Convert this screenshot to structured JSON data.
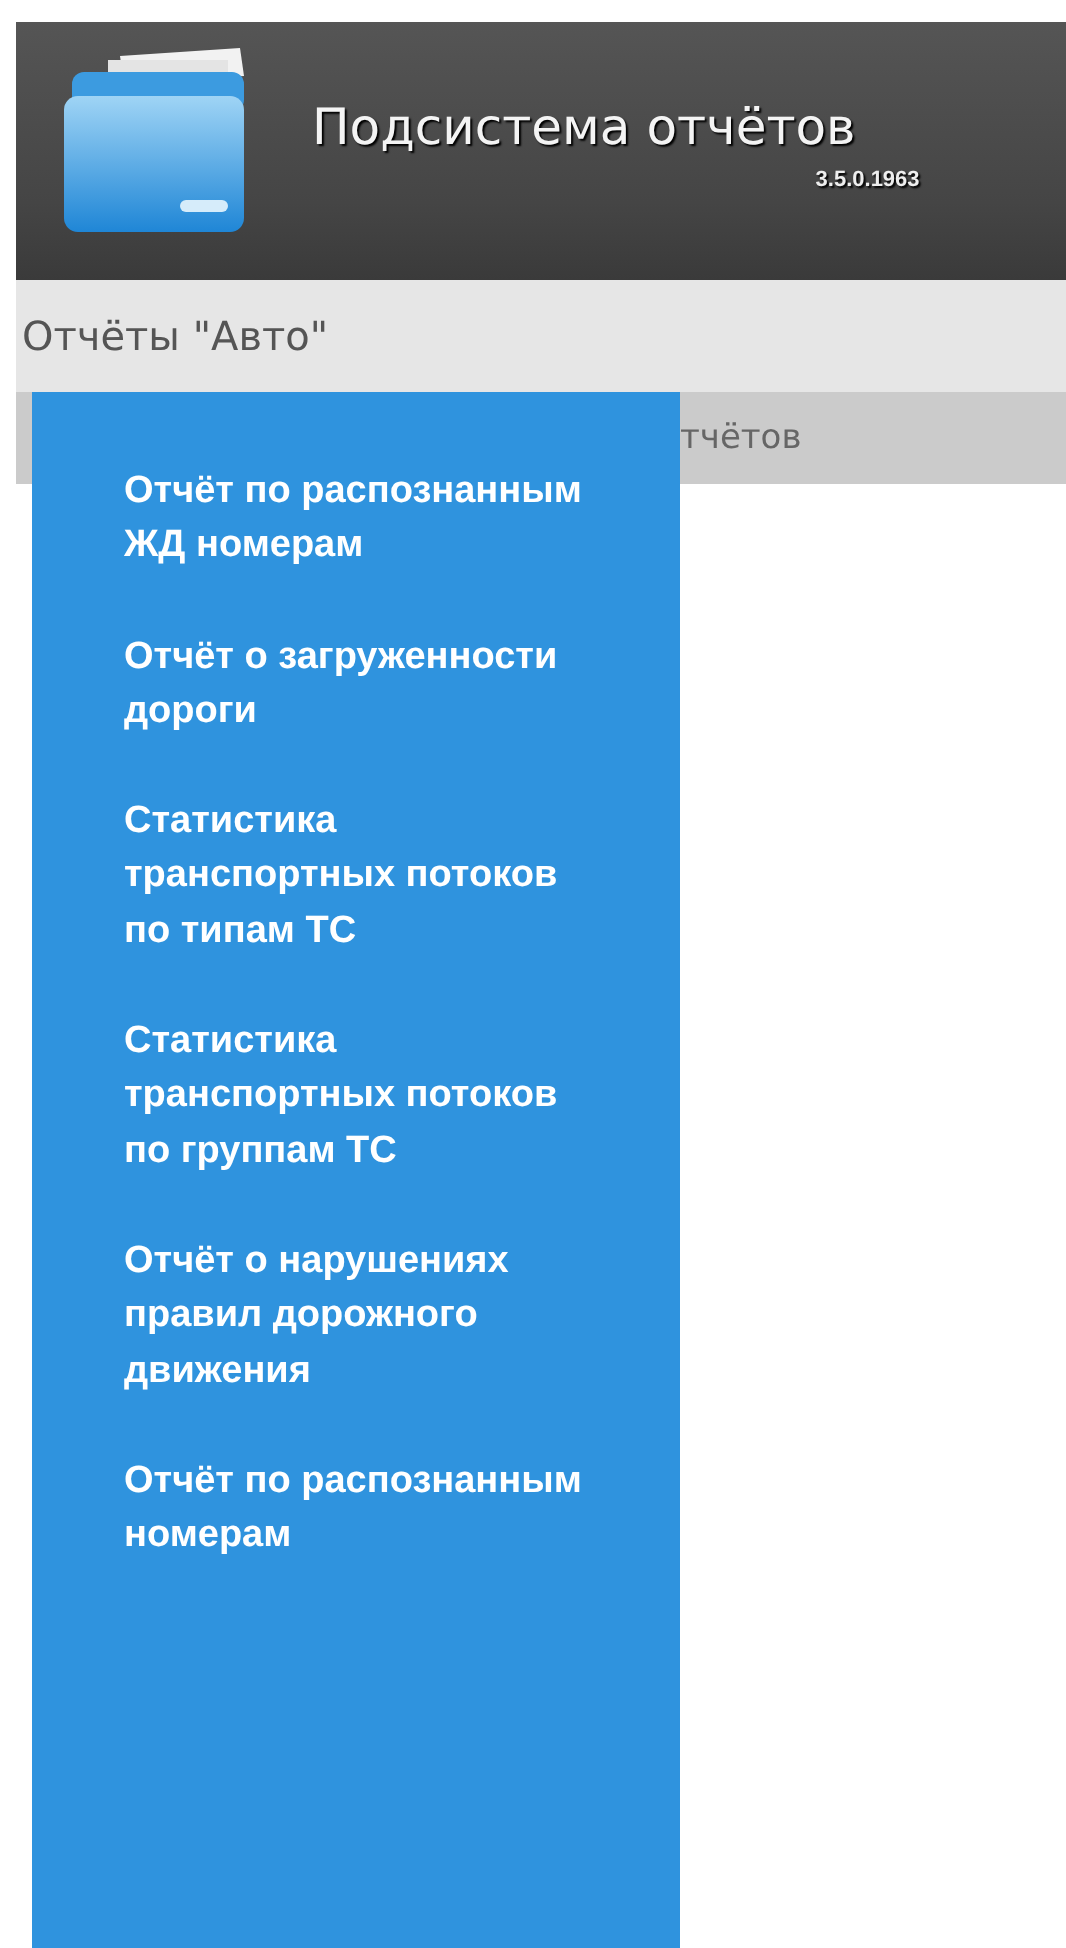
{
  "header": {
    "title": "Подсистема отчётов",
    "version": "3.5.0.1963"
  },
  "nav": {
    "title": "Отчёты \"Авто\""
  },
  "tab_bar": {
    "tab_text": "тчётов"
  },
  "dropdown": {
    "items": [
      {
        "label": "Отчёт по распознанным ЖД номерам"
      },
      {
        "label": "Отчёт о загруженности дороги"
      },
      {
        "label": "Статистика транспортных потоков по типам ТС"
      },
      {
        "label": "Статистика транспортных потоков по группам ТС"
      },
      {
        "label": "Отчёт о нарушениях правил дорожного движения"
      },
      {
        "label": "Отчёт по распознанным номерам"
      }
    ]
  }
}
